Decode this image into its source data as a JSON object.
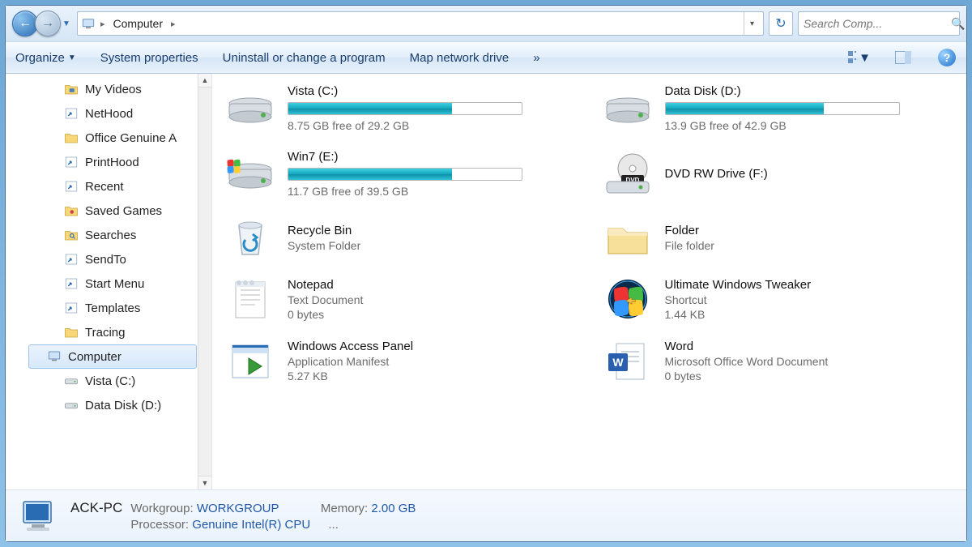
{
  "breadcrumb": {
    "location": "Computer"
  },
  "search": {
    "placeholder": "Search Comp..."
  },
  "toolbar": {
    "organize": "Organize",
    "sysprops": "System properties",
    "uninstall": "Uninstall or change a program",
    "mapdrive": "Map network drive",
    "overflow": "»"
  },
  "sidebar": {
    "items": [
      {
        "label": "My Videos",
        "icon": "folder-video"
      },
      {
        "label": "NetHood",
        "icon": "shortcut-folder"
      },
      {
        "label": "Office Genuine A",
        "icon": "folder"
      },
      {
        "label": "PrintHood",
        "icon": "shortcut-folder"
      },
      {
        "label": "Recent",
        "icon": "shortcut-folder"
      },
      {
        "label": "Saved Games",
        "icon": "folder-games"
      },
      {
        "label": "Searches",
        "icon": "folder-search"
      },
      {
        "label": "SendTo",
        "icon": "shortcut-folder"
      },
      {
        "label": "Start Menu",
        "icon": "shortcut-folder"
      },
      {
        "label": "Templates",
        "icon": "shortcut-folder"
      },
      {
        "label": "Tracing",
        "icon": "folder"
      }
    ],
    "computer": "Computer",
    "drives": [
      {
        "label": "Vista (C:)"
      },
      {
        "label": "Data Disk (D:)"
      }
    ]
  },
  "drives": [
    {
      "name": "Vista (C:)",
      "free": "8.75 GB free of 29.2 GB",
      "fillPct": 70
    },
    {
      "name": "Data Disk (D:)",
      "free": "13.9 GB free of 42.9 GB",
      "fillPct": 68
    },
    {
      "name": "Win7 (E:)",
      "free": "11.7 GB free of 39.5 GB",
      "fillPct": 70
    },
    {
      "name": "DVD RW Drive (F:)",
      "type": "dvd"
    }
  ],
  "items": [
    {
      "name": "Recycle Bin",
      "sub": "System Folder",
      "icon": "recycle"
    },
    {
      "name": "Folder",
      "sub": "File folder",
      "icon": "folder"
    },
    {
      "name": "Notepad",
      "sub": "Text Document",
      "sub2": "0 bytes",
      "icon": "text"
    },
    {
      "name": "Ultimate Windows  Tweaker",
      "sub": "Shortcut",
      "sub2": "1.44 KB",
      "icon": "orb"
    },
    {
      "name": "Windows Access Panel",
      "sub": "Application Manifest",
      "sub2": "5.27 KB",
      "icon": "manifest"
    },
    {
      "name": "Word",
      "sub": "Microsoft Office Word Document",
      "sub2": "0 bytes",
      "icon": "word"
    }
  ],
  "details": {
    "name": "ACK-PC",
    "workgroup_label": "Workgroup:",
    "workgroup": "WORKGROUP",
    "memory_label": "Memory:",
    "memory": "2.00 GB",
    "processor_label": "Processor:",
    "processor": "Genuine Intel(R) CPU",
    "ellipsis": "..."
  }
}
